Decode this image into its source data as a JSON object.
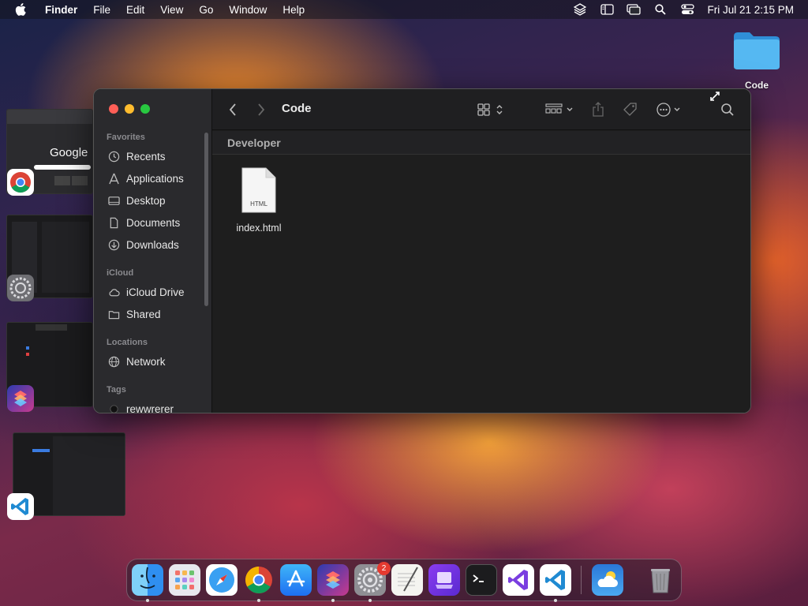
{
  "menubar": {
    "app_name": "Finder",
    "items": [
      "File",
      "Edit",
      "View",
      "Go",
      "Window",
      "Help"
    ],
    "clock": "Fri Jul 21  2:15 PM"
  },
  "desktop": {
    "folder_label": "Code"
  },
  "finder": {
    "title": "Code",
    "path_header": "Developer",
    "sidebar": {
      "favorites_header": "Favorites",
      "favorites": [
        "Recents",
        "Applications",
        "Desktop",
        "Documents",
        "Downloads"
      ],
      "icloud_header": "iCloud",
      "icloud": [
        "iCloud Drive",
        "Shared"
      ],
      "locations_header": "Locations",
      "locations": [
        "Network"
      ],
      "tags_header": "Tags",
      "tags": [
        "rewwrerer"
      ]
    },
    "files": [
      {
        "name": "index.html",
        "type_label": "HTML"
      }
    ]
  },
  "thumbnails": {
    "google_text": "Google"
  },
  "dock": {
    "apps": [
      "finder",
      "launchpad",
      "safari",
      "chrome",
      "app-store",
      "shortcuts",
      "system-settings",
      "textedit",
      "apple-configurator",
      "terminal",
      "visual-studio",
      "vscode",
      "weather",
      "trash"
    ],
    "settings_badge": "2"
  },
  "colors": {
    "close": "#ff5f57",
    "minimize": "#febc2e",
    "zoom": "#28c840",
    "folder": "#4ab0ee"
  }
}
